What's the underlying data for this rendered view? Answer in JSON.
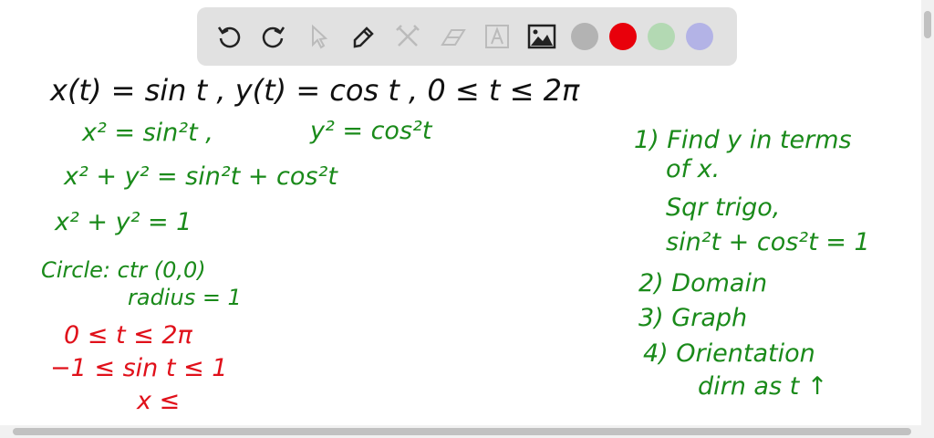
{
  "toolbar": {
    "tools": [
      "undo-icon",
      "redo-icon",
      "select-icon",
      "pen-icon",
      "tools-icon",
      "eraser-icon",
      "text-icon",
      "image-icon"
    ],
    "colors": {
      "gray": "#b3b3b3",
      "red": "#e8000b",
      "green": "#b3d9b3",
      "purple": "#b3b3e6"
    }
  },
  "board": {
    "header": "x(t) = sin t  ,  y(t) = cos t  ,  0 ≤ t ≤ 2π",
    "work": [
      "x² = sin²t  ,",
      "y² = cos²t",
      "x² + y² = sin²t + cos²t",
      "x² + y² = 1",
      "Circle: ctr (0,0)",
      "radius = 1"
    ],
    "red_work": [
      "0 ≤  t  ≤ 2π",
      "−1 ≤ sin t ≤ 1",
      "x ≤"
    ],
    "steps": [
      "1) Find y in terms",
      "of x.",
      "Sqr trigo,",
      "sin²t + cos²t = 1",
      "2) Domain",
      "3) Graph",
      "4) Orientation",
      "dirn  as  t ↑"
    ]
  }
}
